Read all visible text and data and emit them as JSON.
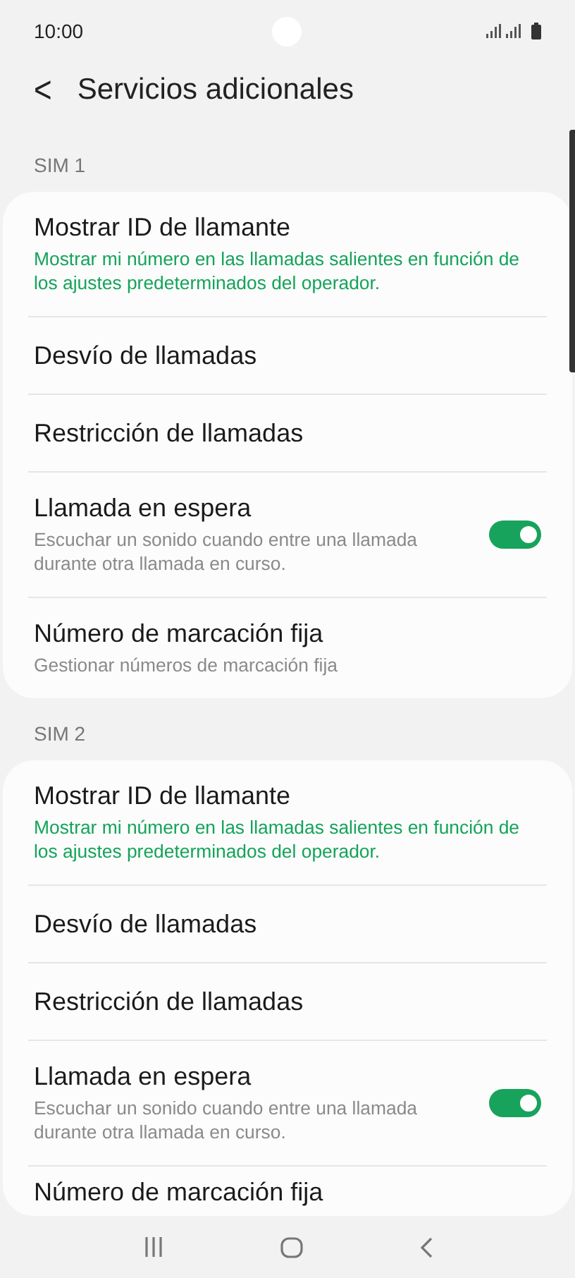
{
  "status_bar": {
    "time": "10:00"
  },
  "header": {
    "back": "<",
    "title": "Servicios adicionales"
  },
  "sections": [
    {
      "label": "SIM 1",
      "items": [
        {
          "kind": "detail",
          "title": "Mostrar ID de llamante",
          "subtitle": "Mostrar mi número en las llamadas salientes en función de los ajustes predeterminados del operador.",
          "accent": true
        },
        {
          "kind": "plain",
          "title": "Desvío de llamadas"
        },
        {
          "kind": "plain",
          "title": "Restricción de llamadas"
        },
        {
          "kind": "toggle",
          "title": "Llamada en espera",
          "subtitle": "Escuchar un sonido cuando entre una llamada durante otra llamada en curso.",
          "on": true
        },
        {
          "kind": "detail",
          "title": "Número de marcación fija",
          "subtitle": "Gestionar números de marcación fija",
          "accent": false
        }
      ]
    },
    {
      "label": "SIM 2",
      "items": [
        {
          "kind": "detail",
          "title": "Mostrar ID de llamante",
          "subtitle": "Mostrar mi número en las llamadas salientes en función de los ajustes predeterminados del operador.",
          "accent": true
        },
        {
          "kind": "plain",
          "title": "Desvío de llamadas"
        },
        {
          "kind": "plain",
          "title": "Restricción de llamadas"
        },
        {
          "kind": "toggle",
          "title": "Llamada en espera",
          "subtitle": "Escuchar un sonido cuando entre una llamada durante otra llamada en curso.",
          "on": true
        },
        {
          "kind": "plain",
          "title": "Número de marcación fija"
        }
      ]
    }
  ]
}
